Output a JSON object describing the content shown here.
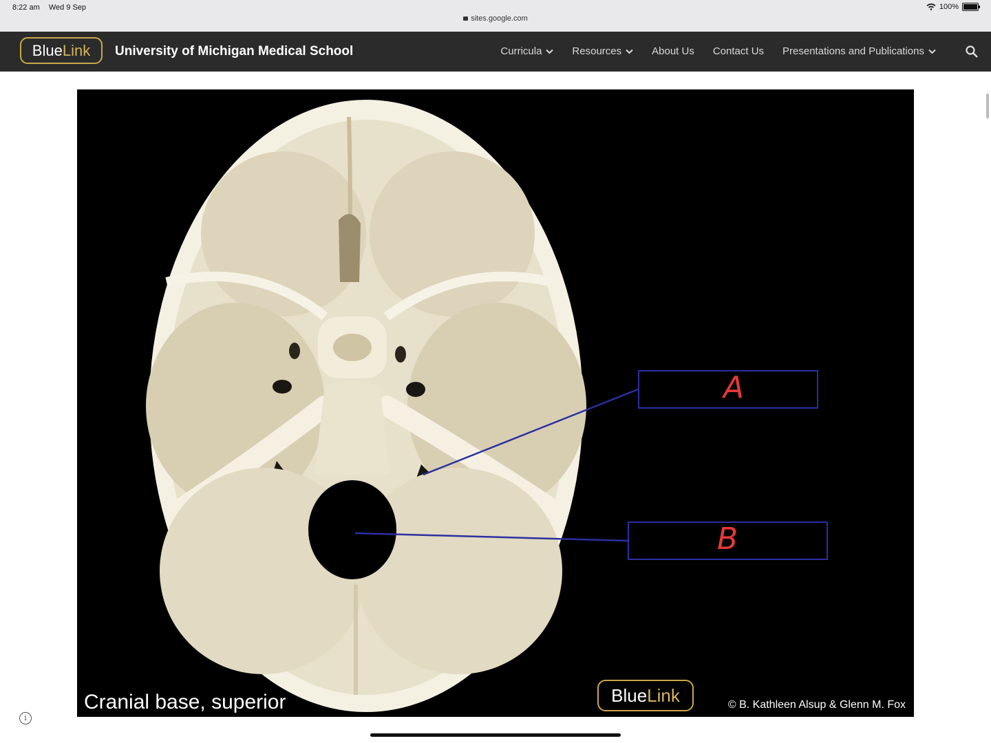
{
  "status_bar": {
    "time": "8:22 am",
    "date": "Wed 9 Sep",
    "url": "sites.google.com",
    "battery": "100%"
  },
  "nav": {
    "logo_blue": "Blue",
    "logo_link": "Link",
    "site_title": "University of Michigan Medical School",
    "items": [
      {
        "label": "Curricula",
        "has_dropdown": true
      },
      {
        "label": "Resources",
        "has_dropdown": true
      },
      {
        "label": "About Us",
        "has_dropdown": false
      },
      {
        "label": "Contact Us",
        "has_dropdown": false
      },
      {
        "label": "Presentations and Publications",
        "has_dropdown": true
      }
    ]
  },
  "figure": {
    "caption": "Cranial base, superior",
    "logo_blue": "Blue",
    "logo_link": "Link",
    "copyright": "© B. Kathleen Alsup & Glenn M. Fox",
    "labels": [
      {
        "letter": "A",
        "color": "#e4383a"
      },
      {
        "letter": "B",
        "color": "#e4383a"
      }
    ],
    "leader_color": "#2b2fa0"
  },
  "colors": {
    "nav_bg": "#2b2b2b",
    "logo_gold": "#c9a84a",
    "figure_bg": "#000000",
    "bone": "#ece6d2"
  }
}
